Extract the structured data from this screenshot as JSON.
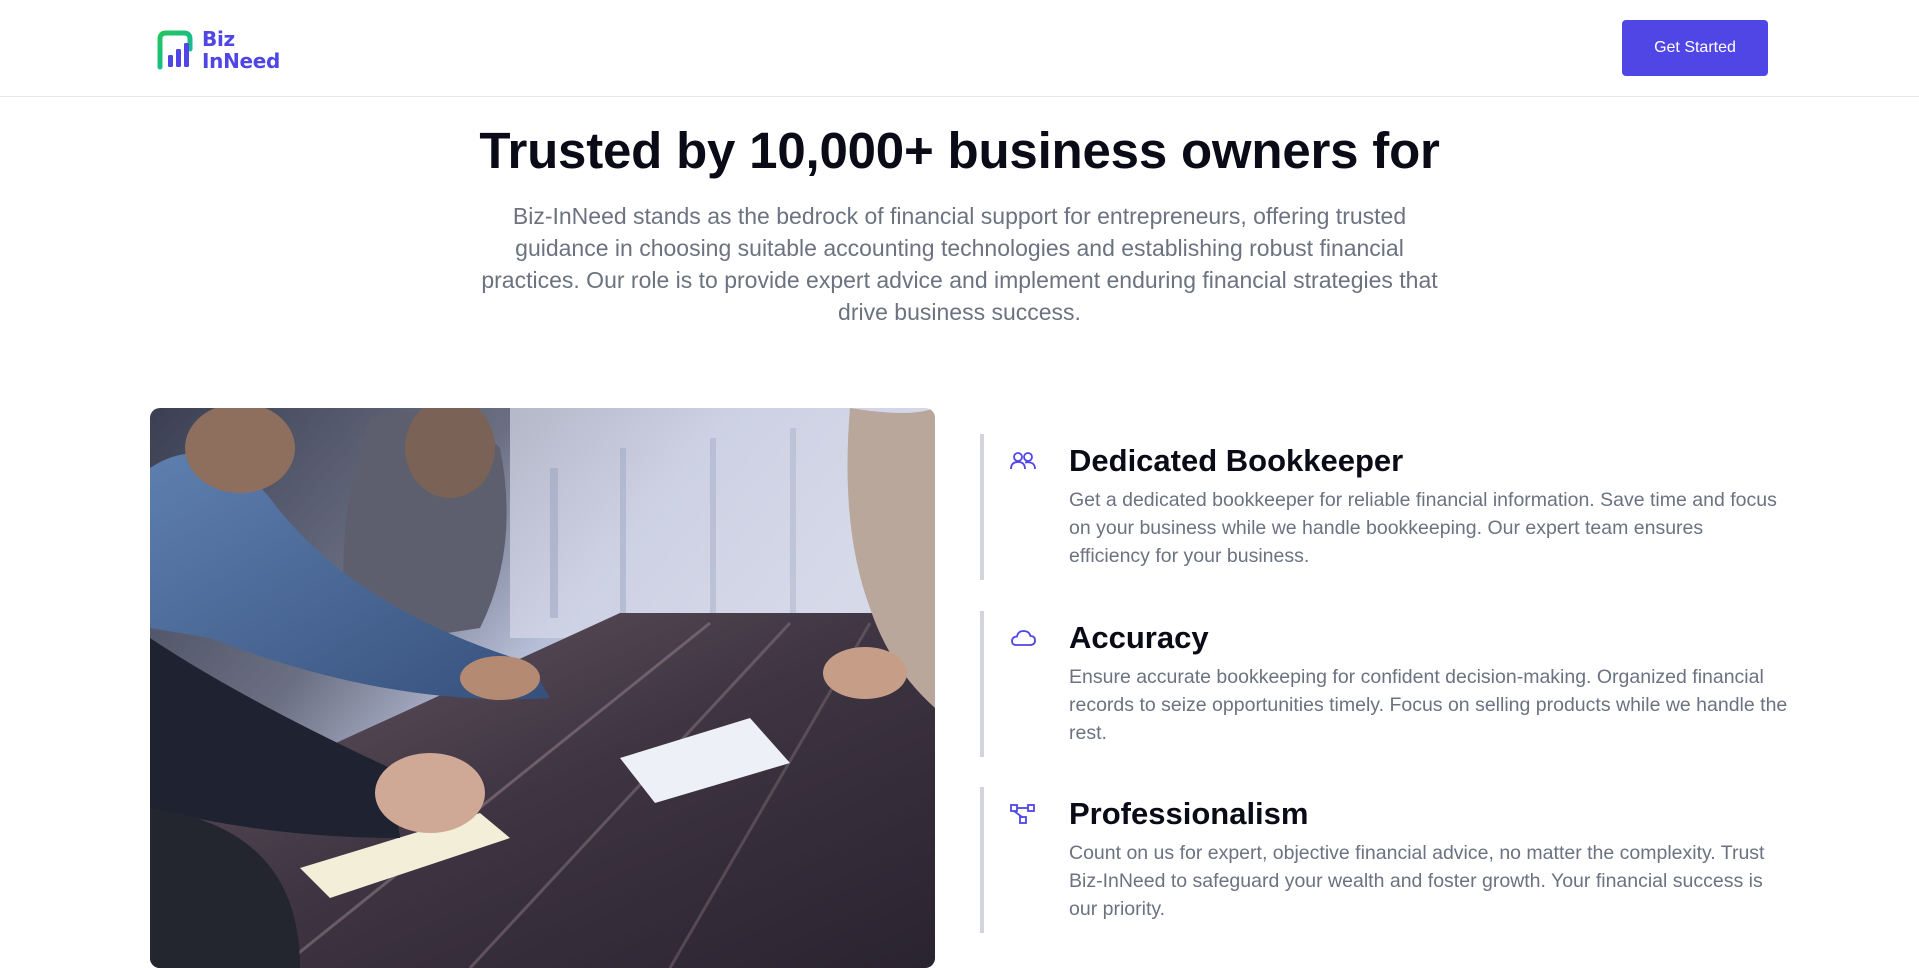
{
  "nav": {
    "logo_line1": "Biz",
    "logo_line2": "InNeed",
    "cta_label": "Get Started"
  },
  "hero": {
    "title": "Trusted by 10,000+ business owners for",
    "subtitle": "Biz-InNeed stands as the bedrock of financial support for entrepreneurs, offering trusted guidance in choosing suitable accounting technologies and establishing robust financial practices. Our role is to provide expert advice and implement enduring financial strategies that drive business success."
  },
  "features": [
    {
      "icon": "users-icon",
      "title": "Dedicated Bookkeeper",
      "description": "Get a dedicated bookkeeper for reliable financial information. Save time and focus on your business while we handle bookkeeping. Our expert team ensures efficiency for your business."
    },
    {
      "icon": "cloud-icon",
      "title": "Accuracy",
      "description": "Ensure accurate bookkeeping for confident decision-making. Organized financial records to seize opportunities timely. Focus on selling products while we handle the rest."
    },
    {
      "icon": "network-icon",
      "title": "Professionalism",
      "description": "Count on us for expert, objective financial advice, no matter the complexity. Trust Biz-InNeed to safeguard your wealth and foster growth. Your financial success is our priority."
    }
  ],
  "colors": {
    "brand": "#4f46e5",
    "logo_green": "#22c55e",
    "heading": "#0b0b17",
    "muted_text": "#6b7280",
    "divider": "#d4d4df"
  }
}
